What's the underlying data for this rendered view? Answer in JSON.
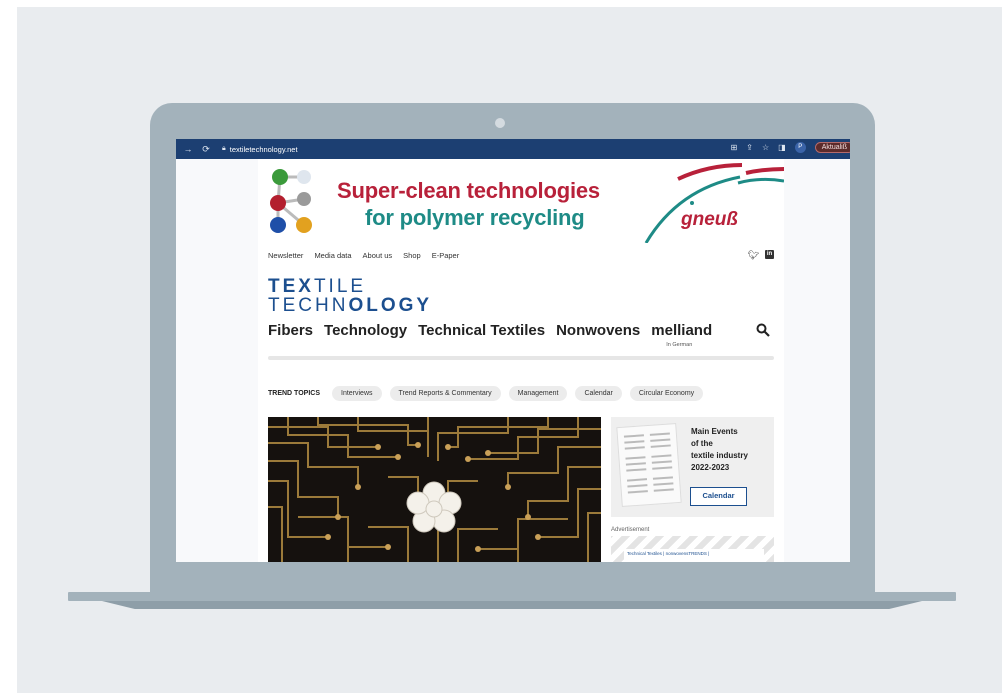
{
  "browser": {
    "url": "textiletechnology.net",
    "update_label": "Aktualiß",
    "profile_initial": "P"
  },
  "ad_banner": {
    "line1": "Super-clean technologies",
    "line2": "for polymer recycling",
    "logo": "gneuß",
    "colors": {
      "red": "#b8213a",
      "teal": "#1e8b86"
    }
  },
  "top_nav": [
    "Newsletter",
    "Media data",
    "About us",
    "Shop",
    "E-Paper"
  ],
  "logo": {
    "line1_bold": "TEX",
    "line1_light": "TILE",
    "line2_light": "TECHN",
    "line2_bold": "OLOGY"
  },
  "main_nav": [
    "Fibers",
    "Technology",
    "Technical Textiles",
    "Nonwovens",
    "melliand"
  ],
  "main_nav_note": "In German",
  "trend_topics": {
    "label": "TREND TOPICS",
    "items": [
      "Interviews",
      "Trend Reports & Commentary",
      "Management",
      "Calendar",
      "Circular Economy"
    ]
  },
  "events_box": {
    "title": "Main Events\nof the\ntextile industry\n2022-2023",
    "button": "Calendar"
  },
  "advertisement": {
    "label": "Advertisement",
    "text": "Technical Textiles | nonwovensTRENDS |"
  },
  "accent_color": "#1c4f8f"
}
